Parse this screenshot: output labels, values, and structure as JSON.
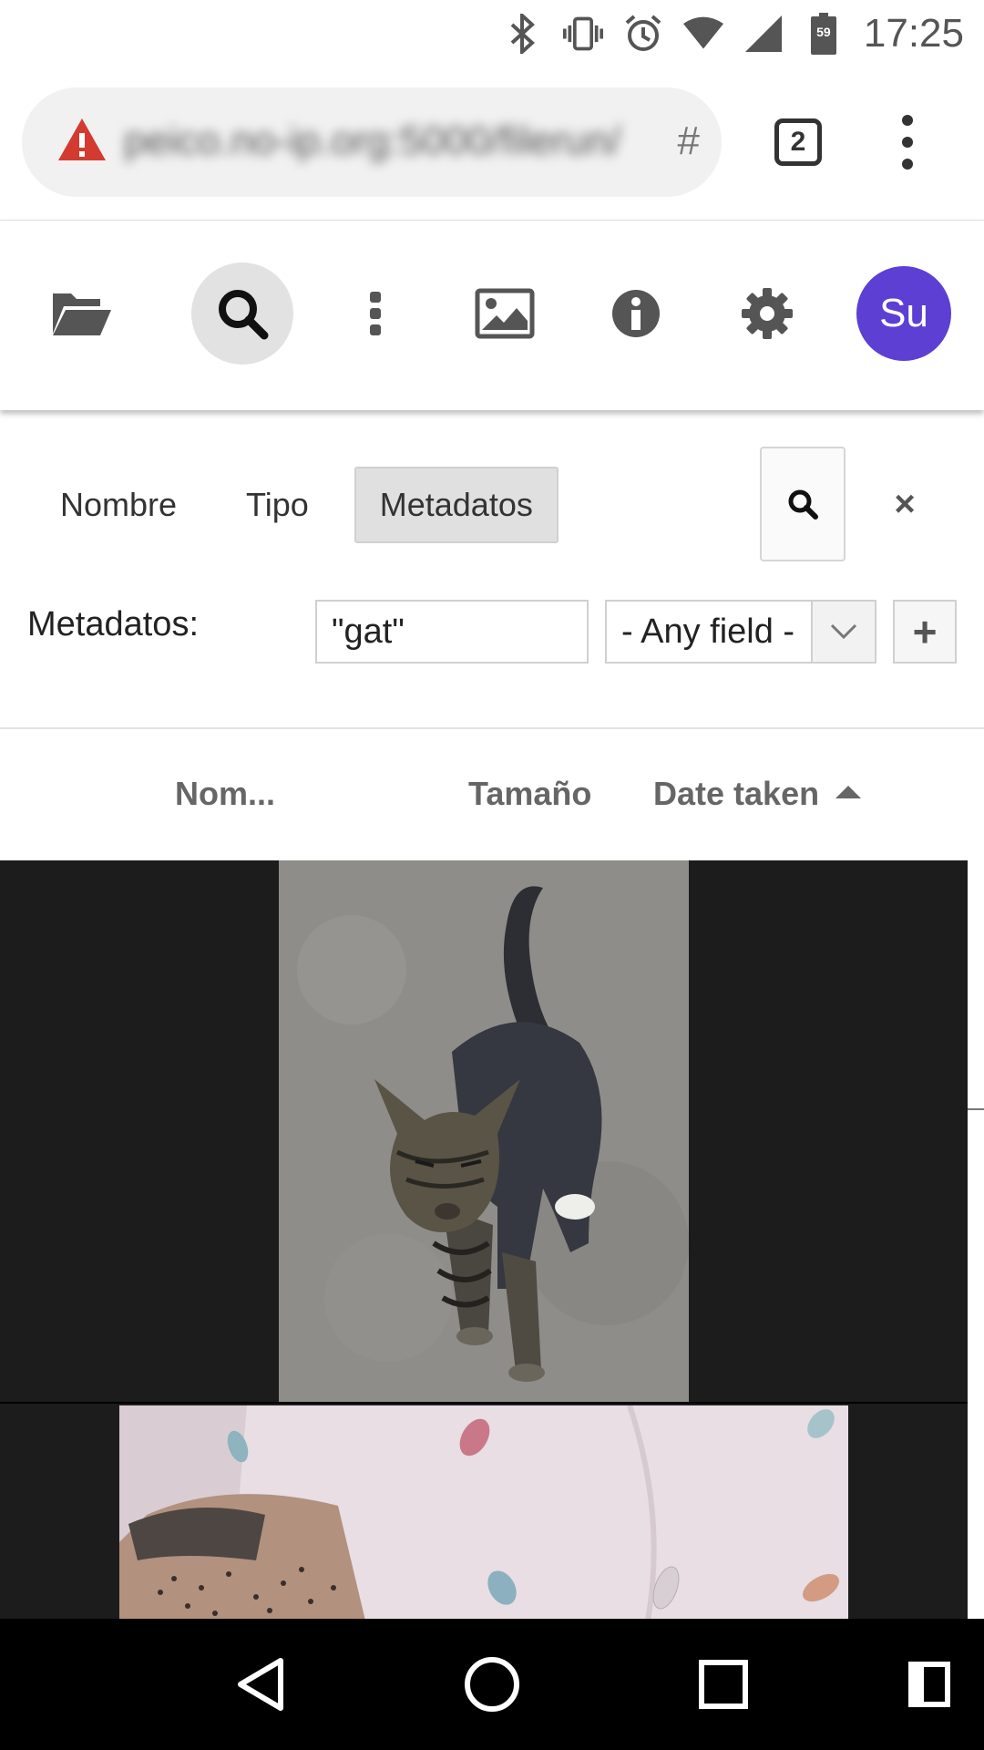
{
  "status_bar": {
    "time": "17:25",
    "battery_level": "59"
  },
  "browser": {
    "url_host": "peico.no-ip.org",
    "url_rest": ":5000/filerun/",
    "url_hash": "#",
    "tab_count": "2"
  },
  "toolbar": {
    "avatar_initials": "Su",
    "accent_color": "#5d3fd3"
  },
  "search": {
    "tabs": [
      {
        "label": "Nombre"
      },
      {
        "label": "Tipo"
      },
      {
        "label": "Metadatos"
      }
    ],
    "active_tab": "Metadatos",
    "metadata_label": "Metadatos:",
    "metadata_value": "\"gat\"",
    "field_select_value": "- Any field -",
    "add_label": "+",
    "close_label": "×"
  },
  "columns": {
    "name": "Nom...",
    "size": "Tamaño",
    "date": "Date taken"
  }
}
